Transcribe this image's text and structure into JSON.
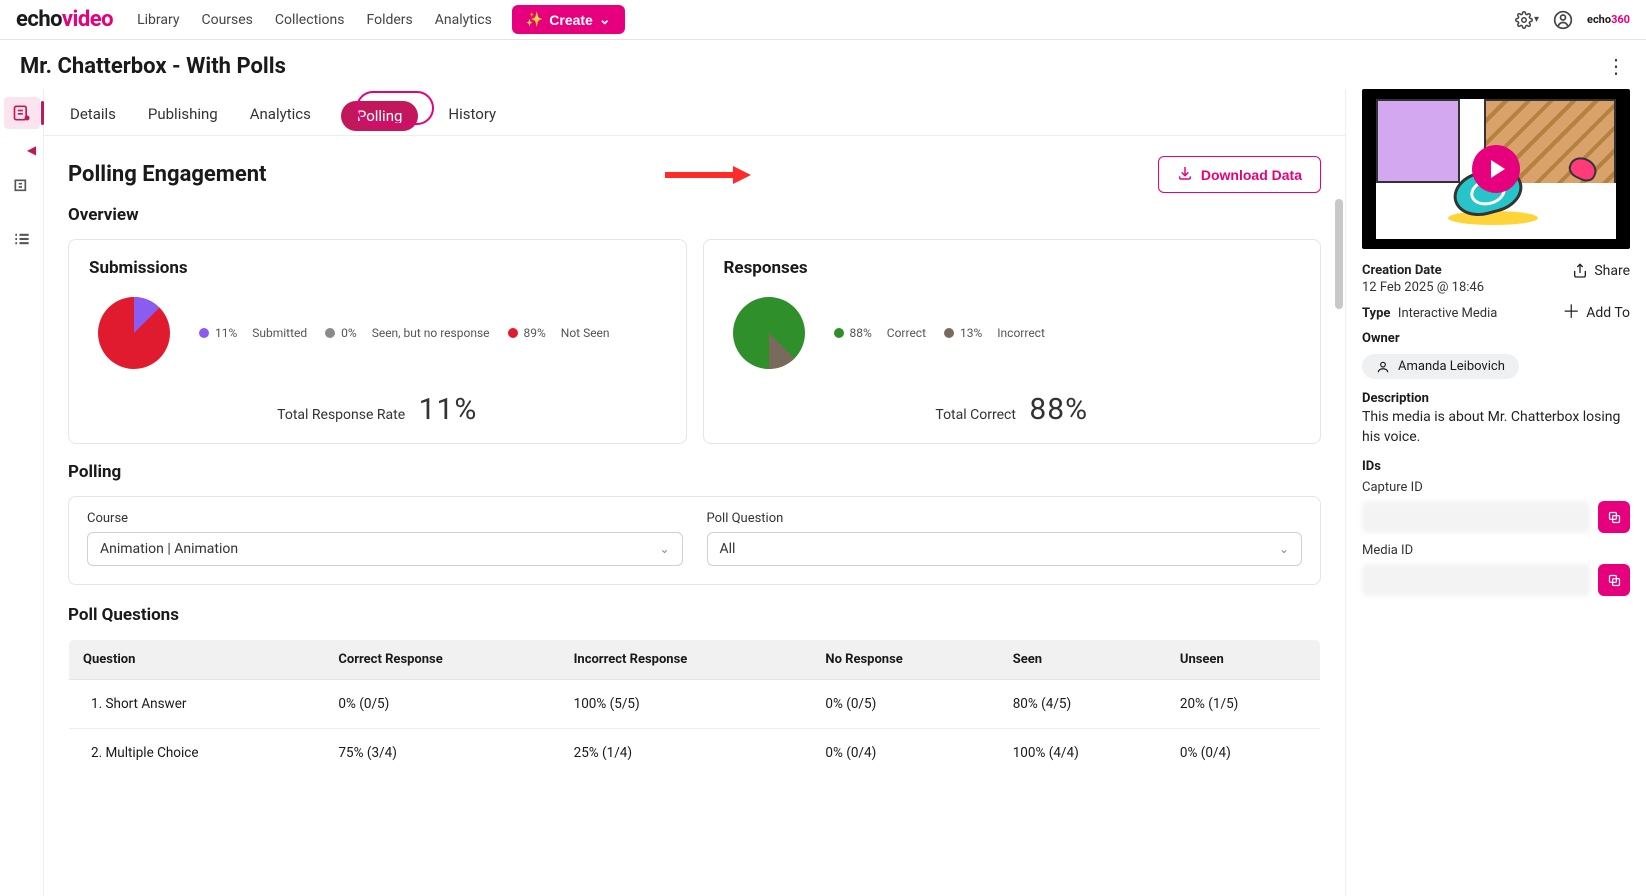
{
  "nav": {
    "logo_a": "echo",
    "logo_b": "video",
    "links": [
      "Library",
      "Courses",
      "Collections",
      "Folders",
      "Analytics"
    ],
    "create": "Create"
  },
  "title": "Mr. Chatterbox - With Polls",
  "tabs": [
    "Details",
    "Publishing",
    "Analytics",
    "Polling",
    "History"
  ],
  "active_tab": "Polling",
  "page": {
    "heading": "Polling Engagement",
    "download": "Download Data",
    "overview": "Overview",
    "polling": "Polling",
    "poll_questions": "Poll Questions"
  },
  "submissions": {
    "title": "Submissions",
    "legend": [
      {
        "pct": "11%",
        "label": "Submitted",
        "color": "#8a5cf0"
      },
      {
        "pct": "0%",
        "label": "Seen, but no response",
        "color": "#8a8a8a"
      },
      {
        "pct": "89%",
        "label": "Not Seen",
        "color": "#e01b2f"
      }
    ],
    "total_label": "Total Response Rate",
    "total_value": "11%"
  },
  "responses": {
    "title": "Responses",
    "legend": [
      {
        "pct": "88%",
        "label": "Correct",
        "color": "#2f8f2a"
      },
      {
        "pct": "13%",
        "label": "Incorrect",
        "color": "#7a6a5c"
      }
    ],
    "total_label": "Total Correct",
    "total_value": "88%"
  },
  "filters": {
    "course_label": "Course",
    "course_value": "Animation | Animation",
    "pq_label": "Poll Question",
    "pq_value": "All"
  },
  "table": {
    "headers": [
      "Question",
      "Correct Response",
      "Incorrect Response",
      "No Response",
      "Seen",
      "Unseen"
    ],
    "rows": [
      [
        "1. Short Answer",
        "0% (0/5)",
        "100% (5/5)",
        "0% (0/5)",
        "80% (4/5)",
        "20% (1/5)"
      ],
      [
        "2. Multiple Choice",
        "75% (3/4)",
        "25% (1/4)",
        "0% (0/4)",
        "100% (4/4)",
        "0% (0/4)"
      ]
    ]
  },
  "right": {
    "creation_label": "Creation Date",
    "creation_value": "12 Feb 2025 @ 18:46",
    "share": "Share",
    "type_label": "Type",
    "type_value": "Interactive Media",
    "addto": "Add To",
    "owner_label": "Owner",
    "owner_value": "Amanda Leibovich",
    "desc_label": "Description",
    "desc_value": "This media is about Mr. Chatterbox losing his voice.",
    "ids_label": "IDs",
    "capture_label": "Capture ID",
    "media_label": "Media ID"
  },
  "chart_data": [
    {
      "type": "pie",
      "title": "Submissions",
      "series": [
        {
          "name": "Submitted",
          "value": 11,
          "color": "#8a5cf0"
        },
        {
          "name": "Seen, but no response",
          "value": 0,
          "color": "#8a8a8a"
        },
        {
          "name": "Not Seen",
          "value": 89,
          "color": "#e01b2f"
        }
      ]
    },
    {
      "type": "pie",
      "title": "Responses",
      "series": [
        {
          "name": "Correct",
          "value": 88,
          "color": "#2f8f2a"
        },
        {
          "name": "Incorrect",
          "value": 13,
          "color": "#7a6a5c"
        }
      ]
    }
  ]
}
